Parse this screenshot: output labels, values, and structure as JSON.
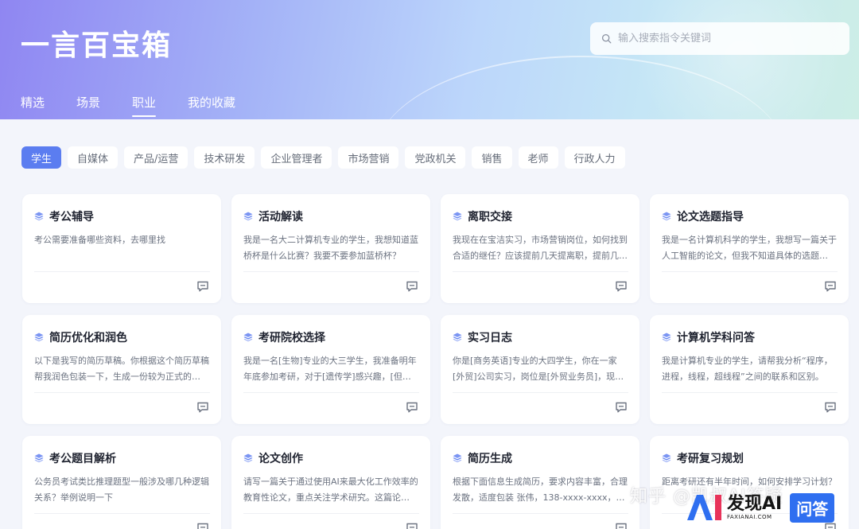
{
  "app": {
    "title": "一言百宝箱"
  },
  "search": {
    "placeholder": "输入搜索指令关键词"
  },
  "nav": [
    {
      "label": "精选",
      "active": false
    },
    {
      "label": "场景",
      "active": false
    },
    {
      "label": "职业",
      "active": true
    },
    {
      "label": "我的收藏",
      "active": false
    }
  ],
  "categories": [
    {
      "label": "学生",
      "active": true
    },
    {
      "label": "自媒体"
    },
    {
      "label": "产品/运营"
    },
    {
      "label": "技术研发"
    },
    {
      "label": "企业管理者"
    },
    {
      "label": "市场营销"
    },
    {
      "label": "党政机关"
    },
    {
      "label": "销售"
    },
    {
      "label": "老师"
    },
    {
      "label": "行政人力"
    }
  ],
  "cards": [
    {
      "title": "考公辅导",
      "desc": "考公需要准备哪些资料，去哪里找"
    },
    {
      "title": "活动解读",
      "desc": "我是一名大二计算机专业的学生，我想知道蓝桥杯是什么比赛？我要不要参加蓝桥杯？"
    },
    {
      "title": "离职交接",
      "desc": "我现在在宝洁实习，市场营销岗位，如何找到合适的继任？应该提前几天提离职，提前几…"
    },
    {
      "title": "论文选题指导",
      "desc": "我是一名计算机科学的学生，我想写一篇关于人工智能的论文，但我不知道具体的选题…"
    },
    {
      "title": "简历优化和润色",
      "desc": "以下是我写的简历草稿。你根据这个简历草稿帮我润色包装一下，生成一份较为正式的…"
    },
    {
      "title": "考研院校选择",
      "desc": "我是一名[生物]专业的大三学生，我准备明年年底参加考研，对于[遗传学]感兴趣，[但是…"
    },
    {
      "title": "实习日志",
      "desc": "你是[商务英语]专业的大四学生，你在一家[外贸]公司实习，岗位是[外贸业务员]，现在请…"
    },
    {
      "title": "计算机学科问答",
      "desc": "我是计算机专业的学生，请帮我分析“程序，进程，线程，超线程”之间的联系和区别。"
    },
    {
      "title": "考公题目解析",
      "desc": "公务员考试类比推理题型一般涉及哪几种逻辑关系？举例说明一下"
    },
    {
      "title": "论文创作",
      "desc": "请写一篇关于通过使用AI来最大化工作效率的教育性论文，重点关注学术研究。这篇论…"
    },
    {
      "title": "简历生成",
      "desc": "根据下面信息生成简历，要求内容丰富，合理发散，适度包装 张伟，138-xxxx-xxxx，zha…"
    },
    {
      "title": "考研复习规划",
      "desc": "距离考研还有半年时间，如何安排学习计划？"
    }
  ],
  "watermark": {
    "text": "知乎 @凯叔AI答疑"
  },
  "badge": {
    "main": "发现AI",
    "sub": "FAXIANAI.COM",
    "box": "问答"
  },
  "colors": {
    "accent": "#5b7df0",
    "icon": "#6f8df5"
  }
}
